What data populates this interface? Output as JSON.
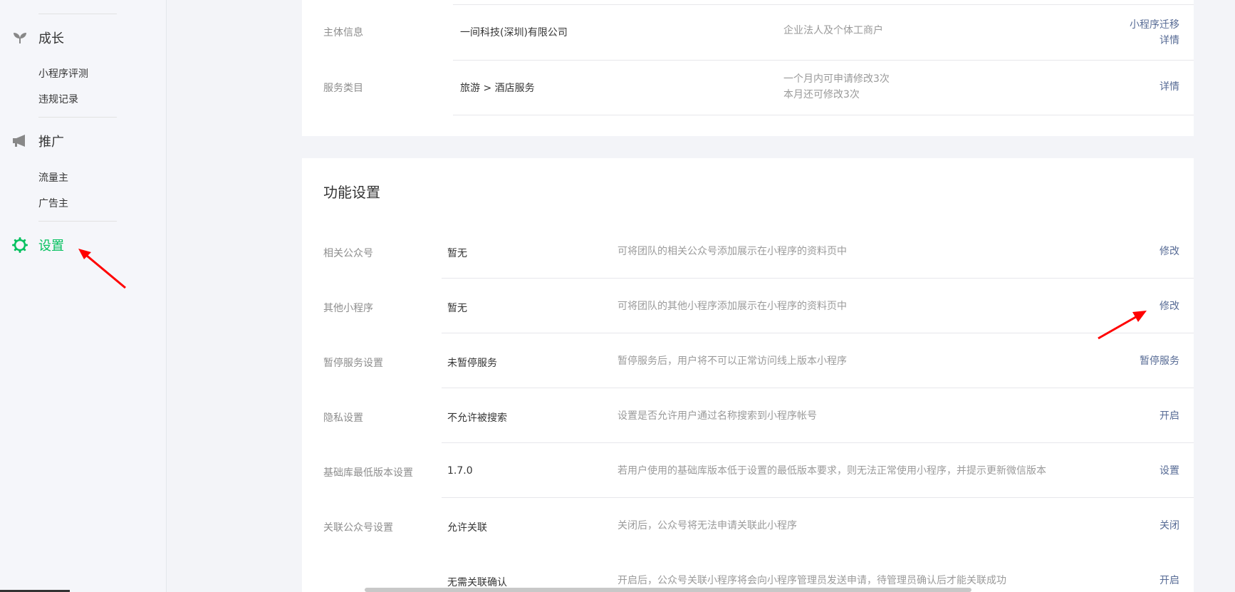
{
  "sidebar": {
    "groups": [
      {
        "label": "成长",
        "icon": "sprout-icon",
        "items": [
          "小程序评测",
          "违规记录"
        ]
      },
      {
        "label": "推广",
        "icon": "megaphone-icon",
        "items": [
          "流量主",
          "广告主"
        ]
      },
      {
        "label": "设置",
        "icon": "gear-icon",
        "items": []
      }
    ],
    "active_color": "#07c160"
  },
  "top_card": {
    "rows": [
      {
        "label": "主体信息",
        "value": "一间科技(深圳)有限公司",
        "desc": "企业法人及个体工商户",
        "action1": "小程序迁移",
        "action2": "详情"
      },
      {
        "label": "服务类目",
        "value": "旅游 > 酒店服务",
        "desc1": "一个月内可申请修改3次",
        "desc2": "本月还可修改3次",
        "action": "详情"
      }
    ]
  },
  "func_card": {
    "title": "功能设置",
    "rows": [
      {
        "label": "相关公众号",
        "value": "暂无",
        "desc": "可将团队的相关公众号添加展示在小程序的资料页中",
        "action": "修改"
      },
      {
        "label": "其他小程序",
        "value": "暂无",
        "desc": "可将团队的其他小程序添加展示在小程序的资料页中",
        "action": "修改"
      },
      {
        "label": "暂停服务设置",
        "value": "未暂停服务",
        "desc": "暂停服务后，用户将不可以正常访问线上版本小程序",
        "action": "暂停服务"
      },
      {
        "label": "隐私设置",
        "value": "不允许被搜索",
        "desc": "设置是否允许用户通过名称搜索到小程序帐号",
        "action": "开启"
      },
      {
        "label": "基础库最低版本设置",
        "value": "1.7.0",
        "desc": "若用户使用的基础库版本低于设置的最低版本要求，则无法正常使用小程序，并提示更新微信版本",
        "action": "设置"
      },
      {
        "label": "关联公众号设置",
        "value": "允许关联",
        "desc": "关闭后，公众号将无法申请关联此小程序",
        "action": "关闭"
      },
      {
        "label": "",
        "value": "无需关联确认",
        "desc": "开启后，公众号关联小程序将会向小程序管理员发送申请，待管理员确认后才能关联成功",
        "action": "开启"
      }
    ]
  },
  "colors": {
    "link": "#576b95",
    "annotation_arrow": "#ff0000"
  }
}
